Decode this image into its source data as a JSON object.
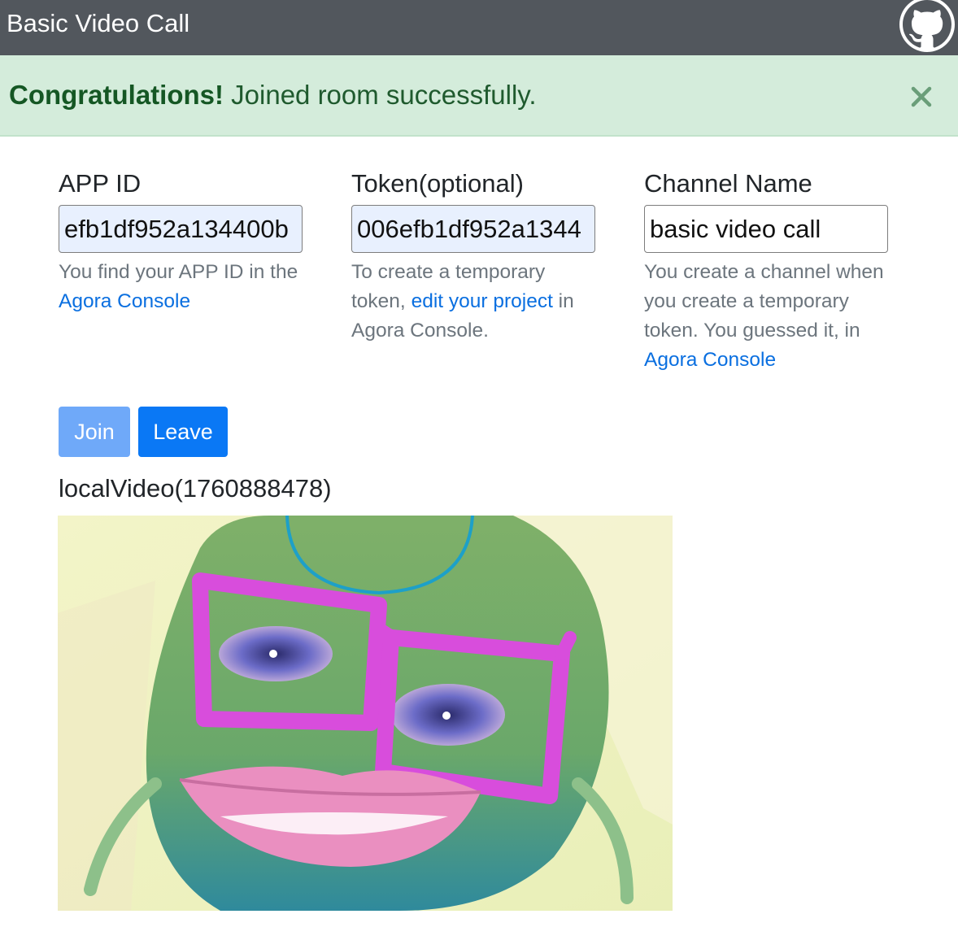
{
  "navbar": {
    "title": "Basic Video Call"
  },
  "alert": {
    "strong": "Congratulations!",
    "message": " Joined room successfully."
  },
  "fields": {
    "app_id": {
      "label": "APP ID",
      "value": "efb1df952a134400b",
      "help_text": "You find your APP ID in the ",
      "help_link": "Agora Console"
    },
    "token": {
      "label": "Token(optional)",
      "value": "006efb1df952a1344",
      "help_before": "To create a temporary token, ",
      "help_link": "edit your project",
      "help_after": " in Agora Console."
    },
    "channel": {
      "label": "Channel Name",
      "value": "basic video call",
      "help_text": "You create a channel when you create a temporary token. You guessed it, in ",
      "help_link": "Agora Console"
    }
  },
  "buttons": {
    "join": "Join",
    "leave": "Leave"
  },
  "video": {
    "label": "localVideo(1760888478)"
  },
  "colors": {
    "navbar": "#52575d",
    "alert_bg": "#d4ecdb",
    "alert_text": "#155724",
    "link": "#0a6fe0",
    "primary": "#0a78f5",
    "primary_disabled": "#6fa9f9"
  }
}
